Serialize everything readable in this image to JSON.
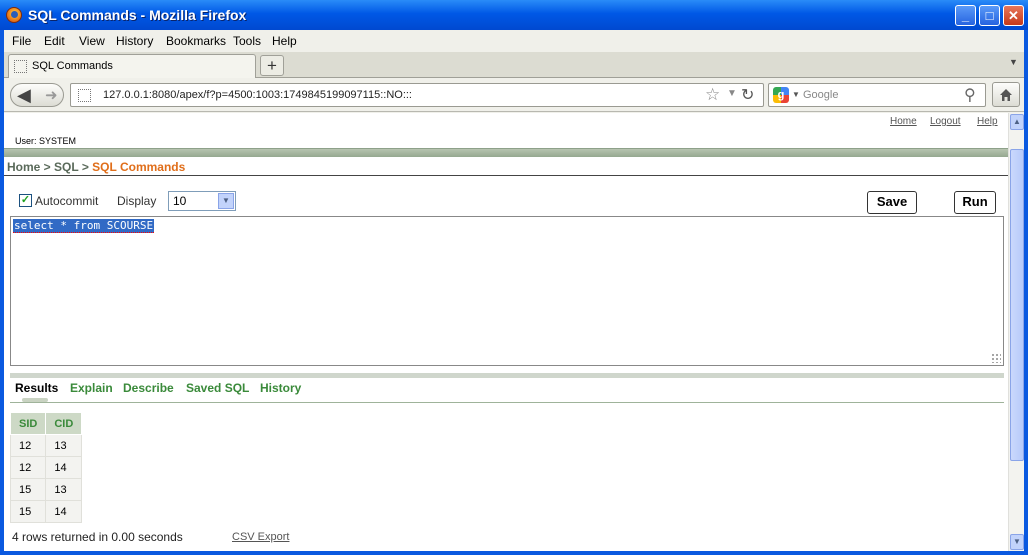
{
  "window": {
    "title": "SQL Commands - Mozilla Firefox",
    "min_glyph": "_",
    "max_glyph": "□",
    "close_glyph": "✕"
  },
  "menu": [
    "File",
    "Edit",
    "View",
    "History",
    "Bookmarks",
    "Tools",
    "Help"
  ],
  "tab": {
    "label": "SQL Commands",
    "new_tab": "+"
  },
  "nav": {
    "url": "127.0.0.1:8080/apex/f?p=4500:1003:1749845199097115::NO:::",
    "search_placeholder": "Google"
  },
  "page": {
    "links": {
      "home": "Home",
      "logout": "Logout",
      "help": "Help"
    },
    "user": "User: SYSTEM",
    "breadcrumb": {
      "home": "Home",
      "sep1": " > ",
      "sql": "SQL",
      "sep2": " > ",
      "current": "SQL Commands"
    },
    "toolbar": {
      "autocommit_label": "Autocommit",
      "autocommit_checked": true,
      "display_label": "Display",
      "display_value": "10",
      "save_label": "Save",
      "run_label": "Run"
    },
    "editor_text": "select * from SCOURSE",
    "result_tabs": [
      "Results",
      "Explain",
      "Describe",
      "Saved SQL",
      "History"
    ],
    "active_tab": "Results",
    "table": {
      "columns": [
        "SID",
        "CID"
      ],
      "rows": [
        [
          "12",
          "13"
        ],
        [
          "12",
          "14"
        ],
        [
          "15",
          "13"
        ],
        [
          "15",
          "14"
        ]
      ]
    },
    "row_count": "4 rows returned in 0.00 seconds",
    "csv_export": "CSV Export"
  },
  "colors": {
    "title_bar": "#0058e6",
    "breadcrumb_current": "#e06e1a",
    "tab_link": "#3a8a3a",
    "selection": "#316ac5"
  }
}
